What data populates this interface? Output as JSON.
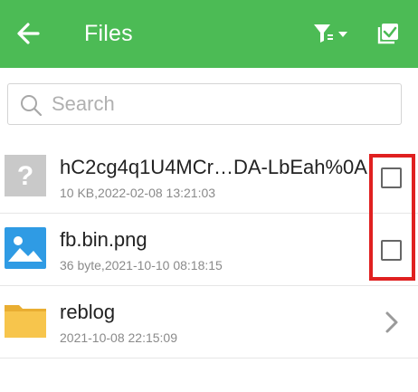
{
  "appbar": {
    "title": "Files",
    "background_color": "#4cbb55",
    "icons": [
      "back-arrow-icon",
      "filter-icon",
      "select-all-icon"
    ]
  },
  "search": {
    "placeholder": "Search",
    "value": "",
    "icon": "search-icon"
  },
  "files": [
    {
      "name": "hC2cg4q1U4MCr…DA-LbEah%0A",
      "meta": "10 KB,2022-02-08 13:21:03",
      "icon": "unknown-file-icon",
      "checked": false
    },
    {
      "name": "fb.bin.png",
      "meta": "36 byte,2021-10-10 08:18:15",
      "icon": "image-file-icon",
      "checked": false
    },
    {
      "name": "reblog",
      "meta": "2021-10-08 22:15:09",
      "icon": "folder-icon"
    }
  ],
  "colors": {
    "accent_green": "#4cbb55",
    "folder_yellow": "#f7c54c",
    "image_blue": "#2f9be4",
    "highlight_red": "#e02020"
  }
}
